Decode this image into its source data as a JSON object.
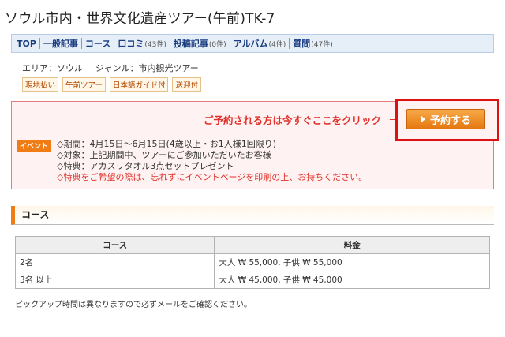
{
  "page": {
    "title": "ソウル市内・世界文化遺産ツアー(午前)TK-7"
  },
  "tabs": [
    {
      "label": "TOP",
      "count": ""
    },
    {
      "label": "一般記事",
      "count": ""
    },
    {
      "label": "コース",
      "count": ""
    },
    {
      "label": "口コミ",
      "count": "(43件)"
    },
    {
      "label": "投稿記事",
      "count": "(0件)"
    },
    {
      "label": "アルバム",
      "count": "(4件)"
    },
    {
      "label": "質問",
      "count": "(47件)"
    }
  ],
  "meta": {
    "area": "エリア：ソウル",
    "genre": "ジャンル：市内観光ツアー"
  },
  "tags": [
    "現地払い",
    "午前ツアー",
    "日本語ガイド付",
    "送迎付"
  ],
  "booking": {
    "prompt": "ご予約される方は今すぐここをクリック",
    "button_label": "予約する"
  },
  "event": {
    "badge": "イベント",
    "lines": [
      "◇期間：4月15日～6月15日(4歳以上・お1人様1回限り)",
      "◇対象：上記期間中、ツアーにご参加いただいたお客様",
      "◇特典：アカスリタオル3点セットプレゼント"
    ],
    "warning": "◇特典をご希望の際は、忘れずにイベントページを印刷の上、お持ちください。"
  },
  "course_section": {
    "heading": "コース"
  },
  "course_table": {
    "headers": [
      "コース",
      "料金"
    ],
    "rows": [
      {
        "course": "2名",
        "price": "大人 ₩ 55,000, 子供 ₩ 55,000"
      },
      {
        "course": "3名 以上",
        "price": "大人 ₩ 45,000, 子供 ₩ 45,000"
      }
    ]
  },
  "note": "ピックアップ時間は異なりますので必ずメールをご確認ください。",
  "colors": {
    "accent_orange": "#f07c16",
    "alert_red": "#e0322a",
    "tab_bg": "#e6eef8",
    "link_blue": "#1a3d80"
  }
}
